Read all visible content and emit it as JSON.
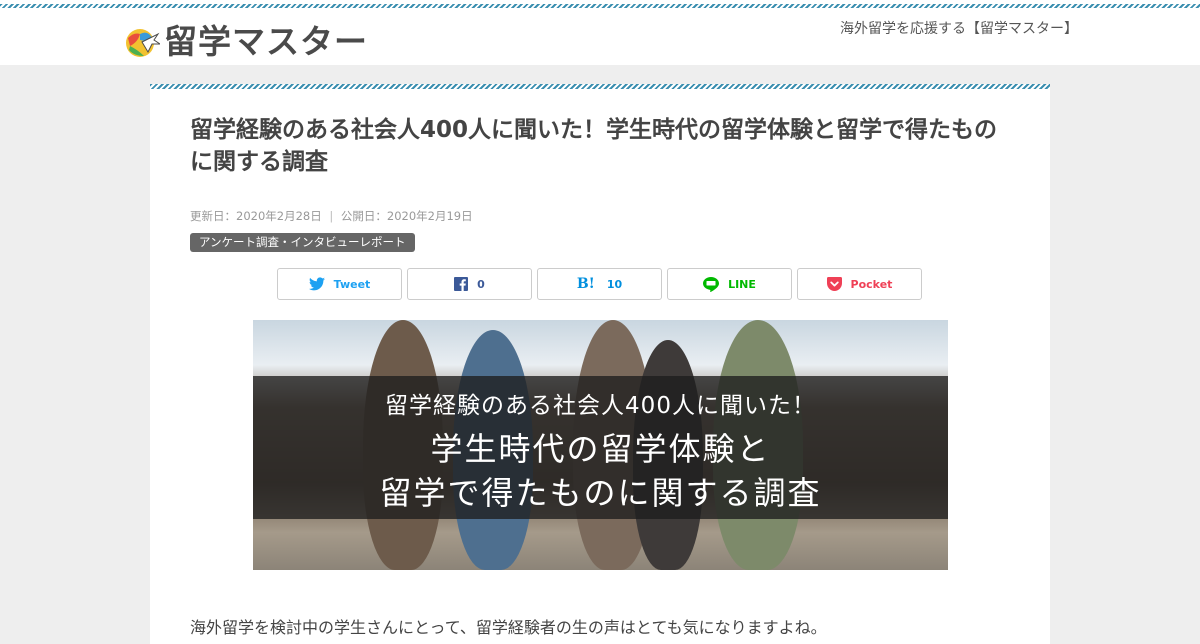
{
  "header": {
    "logo_text": "留学マスター",
    "tagline": "海外留学を応援する【留学マスター】"
  },
  "article": {
    "title": "留学経験のある社会人400人に聞いた！学生時代の留学体験と留学で得たものに関する調査",
    "updated": "更新日：2020年2月28日",
    "published": "公開日：2020年2月19日",
    "meta_separator": "|",
    "category": "アンケート調査・インタビューレポート",
    "intro": "海外留学を検討中の学生さんにとって、留学経験者の生の声はとても気になりますよね。"
  },
  "share": {
    "twitter": "Tweet",
    "facebook": "0",
    "hatena_mark": "B!",
    "hatena": "10",
    "line": "LINE",
    "pocket": "Pocket"
  },
  "hero": {
    "line1": "留学経験のある社会人400人に聞いた！",
    "line2": "学生時代の留学体験と",
    "line3": "留学で得たものに関する調査"
  },
  "colors": {
    "accent_stripe": "#3b8fb0",
    "twitter": "#1da1f2",
    "facebook": "#3b5998",
    "hatena": "#008fde",
    "line": "#00b900",
    "pocket": "#ef4056"
  }
}
